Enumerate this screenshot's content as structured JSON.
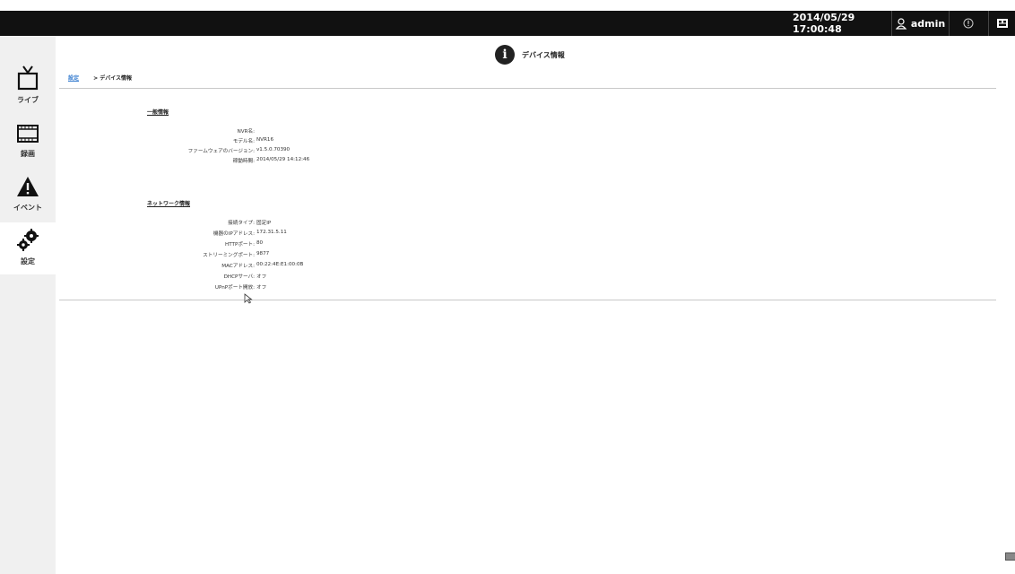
{
  "topbar": {
    "datetime": "2014/05/29 17:00:48",
    "user": "admin",
    "alert_icon": "alert-circle-icon",
    "user_icon": "user-icon",
    "screen_icon": "layout-icon"
  },
  "sidebar": {
    "items": [
      {
        "label": "ライブ",
        "icon": "tv-icon"
      },
      {
        "label": "録画",
        "icon": "film-icon"
      },
      {
        "label": "イベント",
        "icon": "warning-icon"
      },
      {
        "label": "設定",
        "icon": "gears-icon"
      }
    ]
  },
  "page": {
    "title": "デバイス情報",
    "title_icon": "info-icon"
  },
  "breadcrumb": {
    "parent": "設定",
    "current": "> デバイス情報"
  },
  "general": {
    "title": "一般情報",
    "rows": [
      {
        "key": "NVR名:",
        "value": ""
      },
      {
        "key": "モデル名:",
        "value": "NVR16"
      },
      {
        "key": "ファームウェアのバージョン:",
        "value": "v1.5.0.70390"
      },
      {
        "key": "稼動時間:",
        "value": "2014/05/29 14:12:46"
      }
    ]
  },
  "network": {
    "title": "ネットワーク情報",
    "rows": [
      {
        "key": "接続タイプ:",
        "value": "固定IP"
      },
      {
        "key": "機器のIPアドレス:",
        "value": "172.31.5.11"
      },
      {
        "key": "HTTPポート:",
        "value": "80"
      },
      {
        "key": "ストリーミングポート:",
        "value": "9877"
      },
      {
        "key": "MACアドレス:",
        "value": "00:22:4E:E1:00:0B"
      },
      {
        "key": "DHCPサーバ:",
        "value": "オフ"
      },
      {
        "key": "UPnPポート開放:",
        "value": "オフ"
      }
    ]
  },
  "colors": {
    "topbar": "#111111",
    "sidebar": "#f0f0f0",
    "link": "#3a7fd0"
  }
}
